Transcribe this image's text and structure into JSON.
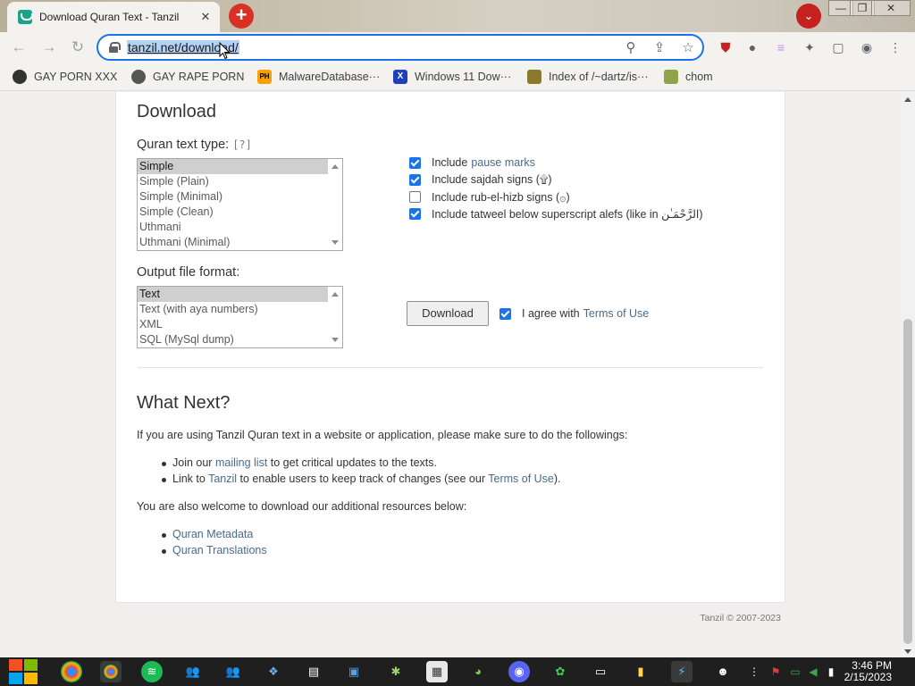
{
  "browser": {
    "tab_title": "Download Quran Text - Tanzil",
    "tab_close": "✕",
    "new_tab": "+",
    "url": "tanzil.net/download/",
    "window_controls": [
      "—",
      "❐",
      "✕"
    ],
    "bookmarks": [
      {
        "label": "GAY PORN XXX",
        "icon": "github-icon"
      },
      {
        "label": "GAY RAPE PORN",
        "icon": "globe-icon"
      },
      {
        "label": "MalwareDatabase···",
        "icon": "ph-icon"
      },
      {
        "label": "Windows 11 Dow···",
        "icon": "x-icon"
      },
      {
        "label": "Index of /~dartz/is···",
        "icon": "folder-icon"
      },
      {
        "label": "chom",
        "icon": "chom-icon"
      }
    ]
  },
  "page": {
    "download_heading": "Download",
    "quran_text_type_label": "Quran text type:",
    "help_link": "[?]",
    "text_types": [
      "Simple",
      "Simple (Plain)",
      "Simple (Minimal)",
      "Simple (Clean)",
      "Uthmani",
      "Uthmani (Minimal)"
    ],
    "selected_text_type": "Simple",
    "options": [
      {
        "pre": "Include ",
        "link": "pause marks",
        "post": "",
        "checked": true
      },
      {
        "pre": "Include sajdah signs (۩)",
        "link": "",
        "post": "",
        "checked": true
      },
      {
        "pre": "Include rub-el-hizb signs (۞)",
        "link": "",
        "post": "",
        "checked": false
      },
      {
        "pre": "Include tatweel below superscript alefs (like in الرَّحْمَـٰن)",
        "link": "",
        "post": "",
        "checked": true
      }
    ],
    "output_format_label": "Output file format:",
    "formats": [
      "Text",
      "Text (with aya numbers)",
      "XML",
      "SQL (MySql dump)"
    ],
    "selected_format": "Text",
    "download_button": "Download",
    "agree_pre": "I agree with ",
    "agree_link": "Terms of Use",
    "agree_checked": true,
    "what_next_heading": "What Next?",
    "what_next_intro": "If you are using Tanzil Quran text in a website or application, please make sure to do the followings:",
    "bullets": [
      {
        "pre": "Join our ",
        "link": "mailing list",
        "post": " to get critical updates to the texts."
      },
      {
        "pre": "Link to ",
        "link": "Tanzil",
        "post": " to enable users to keep track of changes (see our ",
        "link2": "Terms of Use",
        "post2": ")."
      }
    ],
    "additional_intro": "You are also welcome to download our additional resources below:",
    "resources": [
      "Quran Metadata",
      "Quran Translations"
    ],
    "footer": "Tanzil © 2007-2023"
  },
  "taskbar": {
    "time": "3:46 PM",
    "date": "2/15/2023"
  },
  "colors": {
    "accent": "#1a73e8",
    "link": "#4a6a8a",
    "new_tab_red": "#d93025"
  }
}
